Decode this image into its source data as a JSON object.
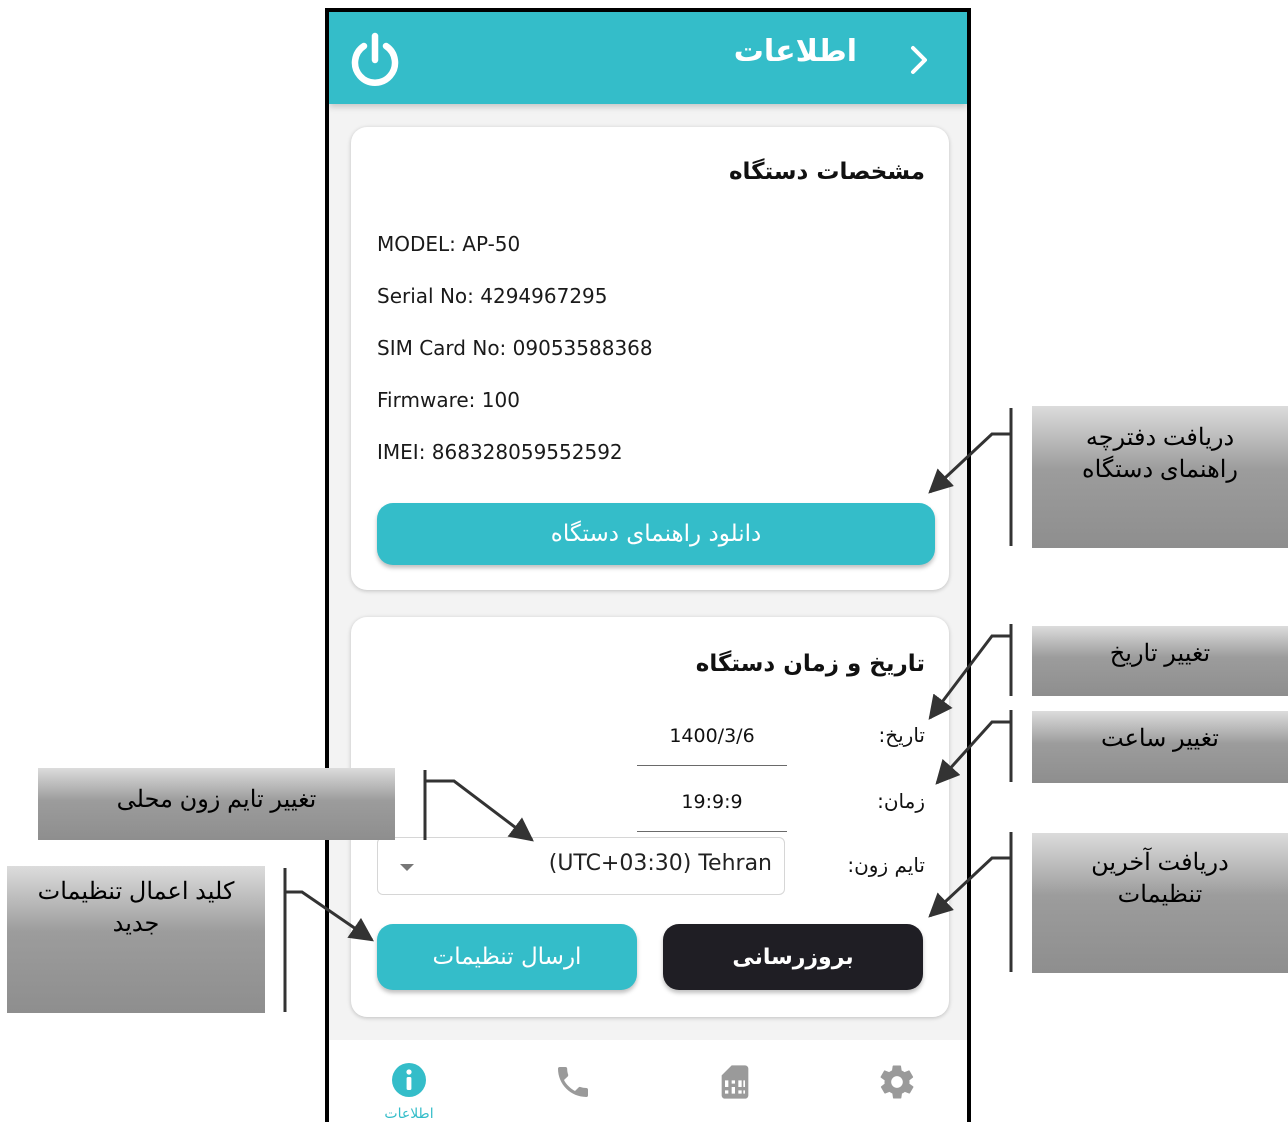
{
  "header": {
    "title": "اطلاعات",
    "back_icon": "chevron-right-icon",
    "power_icon": "power-icon"
  },
  "device_card": {
    "title": "مشخصات دستگاه",
    "specs": [
      "MODEL: AP-50",
      "Serial No: 4294967295",
      "SIM Card No: 09053588368",
      "Firmware: 100",
      "IMEI: 868328059552592"
    ],
    "download_button": "دانلود راهنمای دستگاه"
  },
  "datetime_card": {
    "title": "تاریخ و زمان دستگاه",
    "date_label": "تاریخ:",
    "date_value": "1400/3/6",
    "time_label": "زمان:",
    "time_value": "19:9:9",
    "timezone_label": "تایم زون:",
    "timezone_value": "(UTC+03:30) Tehran",
    "update_button": "بروزرسانی",
    "send_button": "ارسال تنظیمات"
  },
  "bottom_nav": [
    {
      "icon": "info-icon",
      "label": "اطلاعات",
      "active": true
    },
    {
      "icon": "phone-icon",
      "label": "",
      "active": false
    },
    {
      "icon": "sim-card-icon",
      "label": "",
      "active": false
    },
    {
      "icon": "gear-icon",
      "label": "",
      "active": false
    }
  ],
  "callouts": {
    "manual": [
      "دریافت دفترچه",
      "راهنمای دستگاه"
    ],
    "change_date": "تغییر تاریخ",
    "change_time": "تغییر ساعت",
    "latest_settings": [
      "دریافت آخرین",
      "تنظیمات"
    ],
    "timezone": "تغییر تایم زون محلی",
    "apply_settings": [
      "کلید اعمال تنظیمات",
      "جدید"
    ]
  },
  "colors": {
    "accent": "#34bdc9",
    "dark_button": "#1f1e24",
    "background": "#f3f3f3"
  }
}
